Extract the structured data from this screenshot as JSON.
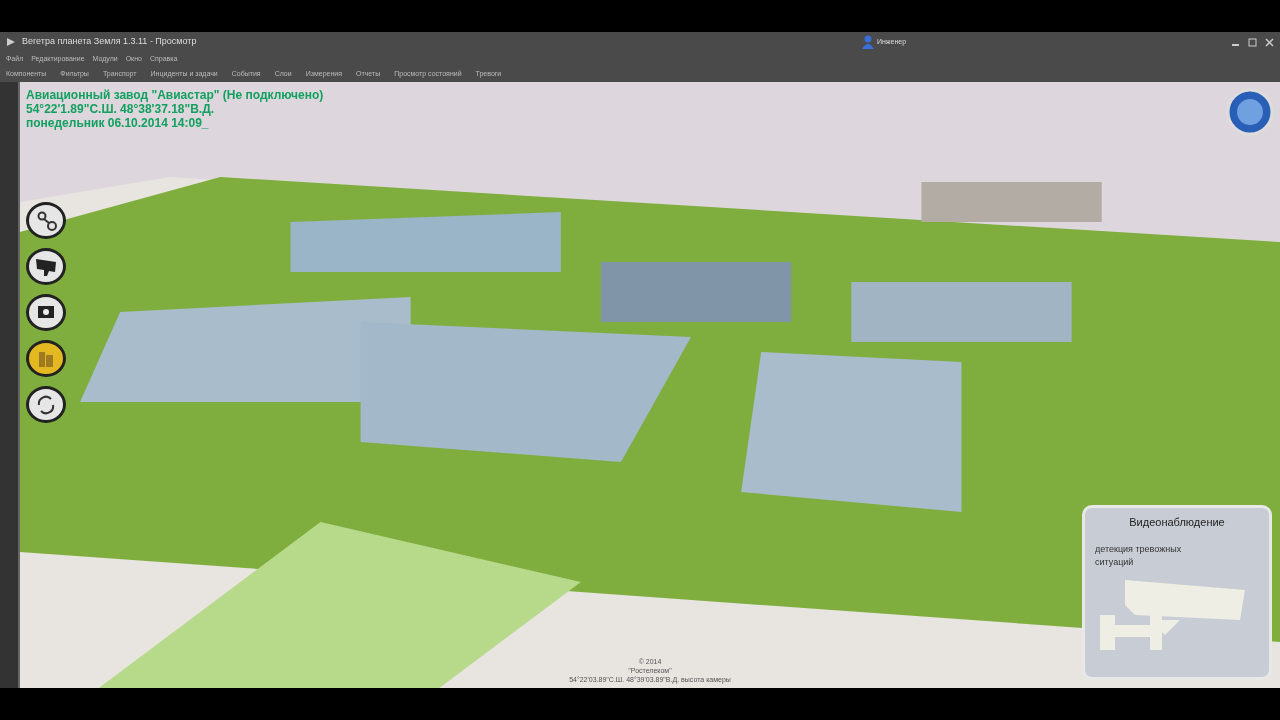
{
  "window": {
    "title": "Вегетра планета Земля 1.3.11 - Просмотр",
    "user": "Инженер"
  },
  "menu": [
    "Файл",
    "Редактирование",
    "Модули",
    "Окно",
    "Справка"
  ],
  "toolbar": [
    "Компоненты",
    "Фильтры",
    "Транспорт",
    "Инциденты и задачи",
    "События",
    "Слои",
    "Измерения",
    "Отчеты",
    "Просмотр состояний",
    "Тревоги"
  ],
  "overlay": {
    "lines": [
      "Авиационный завод \"Авиастар\" (Не подключено)",
      "54°22'1.89\"С.Ш. 48°38'37.18\"В.Д.",
      "понедельник 06.10.2014 14:09_"
    ]
  },
  "side_buttons": [
    {
      "kind": "route",
      "selected": false
    },
    {
      "kind": "camera",
      "selected": false
    },
    {
      "kind": "photo",
      "selected": false
    },
    {
      "kind": "building",
      "selected": true
    },
    {
      "kind": "refresh",
      "selected": false
    }
  ],
  "video_panel": {
    "title": "Видеонаблюдение",
    "text": "детекция тревожных ситуаций"
  },
  "attribution": [
    "© 2014",
    "\"Ростелеком\"",
    "54°22'03.89\"С.Ш. 48°39'03.89\"В.Д. высота камеры"
  ]
}
